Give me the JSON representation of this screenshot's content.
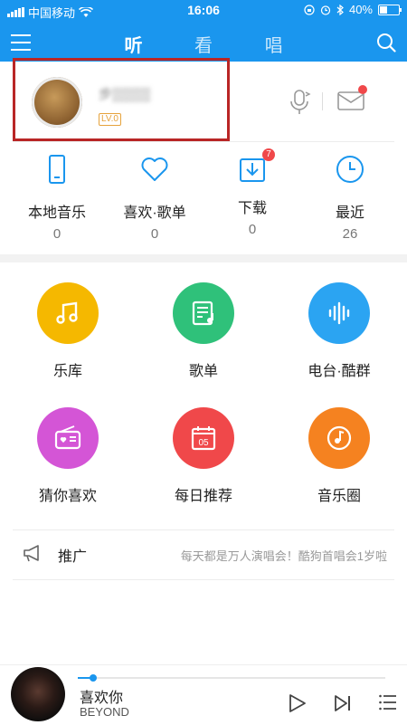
{
  "status_bar": {
    "carrier": "中国移动",
    "time": "16:06",
    "battery_text": "40%",
    "battery_level": 0.4
  },
  "nav": {
    "tabs": [
      "听",
      "看",
      "唱"
    ],
    "active_tab": "听"
  },
  "user": {
    "name": "步▒▒▒▒",
    "level": "LV.0"
  },
  "quick_actions": [
    {
      "label": "本地音乐",
      "count": "0",
      "icon": "phone-icon"
    },
    {
      "label": "喜欢·歌单",
      "count": "0",
      "icon": "heart-icon"
    },
    {
      "label": "下载",
      "count": "0",
      "icon": "download-icon",
      "badge": "7"
    },
    {
      "label": "最近",
      "count": "26",
      "icon": "clock-icon"
    }
  ],
  "grid": [
    {
      "label": "乐库",
      "color": "#f5b800",
      "icon": "music-note-icon"
    },
    {
      "label": "歌单",
      "color": "#2fc17a",
      "icon": "playlist-icon"
    },
    {
      "label": "电台·酷群",
      "color": "#2ba4f2",
      "icon": "waveform-icon"
    },
    {
      "label": "猜你喜欢",
      "color": "#d455d6",
      "icon": "radio-icon"
    },
    {
      "label": "每日推荐",
      "color": "#f0484a",
      "icon": "calendar-icon",
      "day": "05"
    },
    {
      "label": "音乐圈",
      "color": "#f58220",
      "icon": "music-circle-icon"
    }
  ],
  "promo": {
    "title": "推广",
    "text": "每天都是万人演唱会！酷狗首唱会1岁啦"
  },
  "player": {
    "song": "喜欢你",
    "artist": "BEYOND",
    "progress": 0.05
  },
  "colors": {
    "brand": "#1a96ee",
    "badge": "#f0484a",
    "highlight_border": "#b92626"
  }
}
